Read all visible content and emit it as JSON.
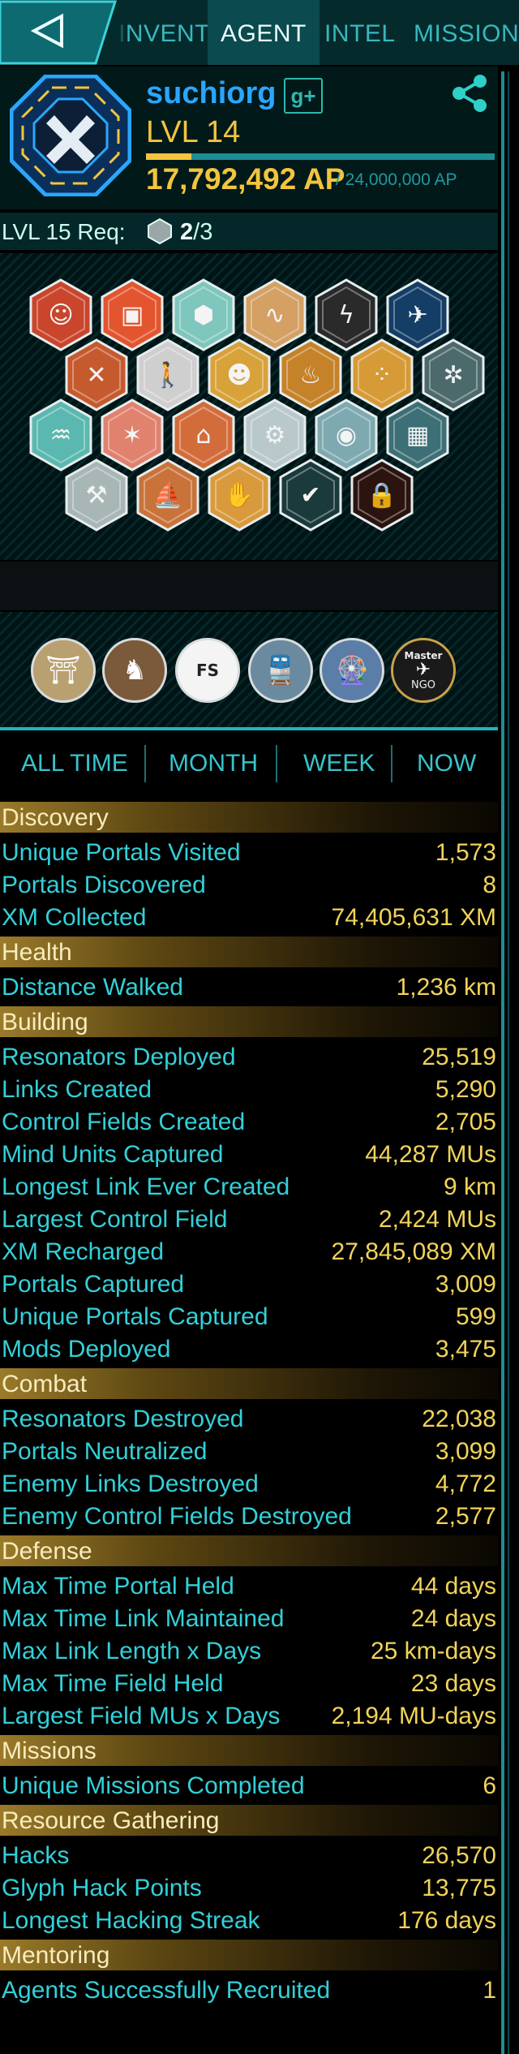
{
  "tabs": [
    {
      "label": "INVENTORY",
      "active": false
    },
    {
      "label": "AGENT",
      "active": true
    },
    {
      "label": "INTEL",
      "active": false
    },
    {
      "label": "MISSIONS",
      "active": false
    }
  ],
  "agent": {
    "name": "suchiorg",
    "gplus": "g+",
    "level": "LVL 14",
    "ap": "17,792,492 AP",
    "ap_max": "/ 24,000,000 AP",
    "ap_progress": 0.13
  },
  "level_req": {
    "label": "LVL 15 Req:",
    "have": "2",
    "need": "/3"
  },
  "colors": {
    "accent": "#3fd6dc",
    "gold": "#f2c53d",
    "agent_name": "#2aa6ff"
  },
  "badges": [
    {
      "icon": "tiki-mask-icon",
      "color": "#c9452c"
    },
    {
      "icon": "maze-square-icon",
      "color": "#e3552e"
    },
    {
      "icon": "geodesic-sphere-icon",
      "color": "#7fc6bd"
    },
    {
      "icon": "wave-hand-icon",
      "color": "#d4a064"
    },
    {
      "icon": "lightning-spiral-icon",
      "color": "#2a2a2a"
    },
    {
      "icon": "comm-wings-icon",
      "color": "#143e66"
    },
    {
      "icon": "crossed-tools-icon",
      "color": "#c65a2f"
    },
    {
      "icon": "walker-icon",
      "color": "#cfcfcf"
    },
    {
      "icon": "jester-mask-icon",
      "color": "#d8a23a"
    },
    {
      "icon": "flame-icon",
      "color": "#c58228"
    },
    {
      "icon": "dots-grid-icon",
      "color": "#d69a36"
    },
    {
      "icon": "wheel-icon",
      "color": "#4c6a6c"
    },
    {
      "icon": "fountain-icon",
      "color": "#5bb8b0"
    },
    {
      "icon": "spark-burst-icon",
      "color": "#e0826e"
    },
    {
      "icon": "temple-icon",
      "color": "#d36c3b"
    },
    {
      "icon": "gear-eye-icon",
      "color": "#b9c9cb"
    },
    {
      "icon": "alien-face-icon",
      "color": "#7fa9b0"
    },
    {
      "icon": "cube-icon",
      "color": "#3d7076"
    },
    {
      "icon": "hammer-icon",
      "color": "#a8b6b6"
    },
    {
      "icon": "sailboat-icon",
      "color": "#c9733a"
    },
    {
      "icon": "hand-arc-icon",
      "color": "#d89a3c"
    },
    {
      "icon": "checkmark-icon",
      "color": "#1a3a3c"
    },
    {
      "icon": "padlock-icon",
      "color": "#2b1410"
    }
  ],
  "missions": [
    {
      "icon": "temple-building-icon",
      "label": ""
    },
    {
      "icon": "horse-rider-icon",
      "label": ""
    },
    {
      "icon": "fs-logo-icon",
      "label": "FS"
    },
    {
      "icon": "train-station-icon",
      "label": ""
    },
    {
      "icon": "ferris-wheel-icon",
      "label": ""
    },
    {
      "icon": "airplane-icon",
      "label": "Master",
      "sub": "NGO"
    }
  ],
  "filters": [
    "ALL TIME",
    "MONTH",
    "WEEK",
    "NOW"
  ],
  "stats": [
    {
      "section": "Discovery",
      "rows": [
        {
          "label": "Unique Portals Visited",
          "value": "1,573"
        },
        {
          "label": "Portals Discovered",
          "value": "8"
        },
        {
          "label": "XM Collected",
          "value": "74,405,631 XM"
        }
      ]
    },
    {
      "section": "Health",
      "rows": [
        {
          "label": "Distance Walked",
          "value": "1,236 km"
        }
      ]
    },
    {
      "section": "Building",
      "rows": [
        {
          "label": "Resonators Deployed",
          "value": "25,519"
        },
        {
          "label": "Links Created",
          "value": "5,290"
        },
        {
          "label": "Control Fields Created",
          "value": "2,705"
        },
        {
          "label": "Mind Units Captured",
          "value": "44,287 MUs"
        },
        {
          "label": "Longest Link Ever Created",
          "value": "9 km"
        },
        {
          "label": "Largest Control Field",
          "value": "2,424 MUs"
        },
        {
          "label": "XM Recharged",
          "value": "27,845,089 XM"
        },
        {
          "label": "Portals Captured",
          "value": "3,009"
        },
        {
          "label": "Unique Portals Captured",
          "value": "599"
        },
        {
          "label": "Mods Deployed",
          "value": "3,475"
        }
      ]
    },
    {
      "section": "Combat",
      "rows": [
        {
          "label": "Resonators Destroyed",
          "value": "22,038"
        },
        {
          "label": "Portals Neutralized",
          "value": "3,099"
        },
        {
          "label": "Enemy Links Destroyed",
          "value": "4,772"
        },
        {
          "label": "Enemy Control Fields Destroyed",
          "value": "2,577"
        }
      ]
    },
    {
      "section": "Defense",
      "rows": [
        {
          "label": "Max Time Portal Held",
          "value": "44 days"
        },
        {
          "label": "Max Time Link Maintained",
          "value": "24 days"
        },
        {
          "label": "Max Link Length x Days",
          "value": "25 km-days"
        },
        {
          "label": "Max Time Field Held",
          "value": "23 days"
        },
        {
          "label": "Largest Field MUs x Days",
          "value": "2,194 MU-days"
        }
      ]
    },
    {
      "section": "Missions",
      "rows": [
        {
          "label": "Unique Missions Completed",
          "value": "6"
        }
      ]
    },
    {
      "section": "Resource Gathering",
      "rows": [
        {
          "label": "Hacks",
          "value": "26,570"
        },
        {
          "label": "Glyph Hack Points",
          "value": "13,775"
        },
        {
          "label": "Longest Hacking Streak",
          "value": "176 days"
        }
      ]
    },
    {
      "section": "Mentoring",
      "rows": [
        {
          "label": "Agents Successfully Recruited",
          "value": "1"
        }
      ]
    }
  ]
}
